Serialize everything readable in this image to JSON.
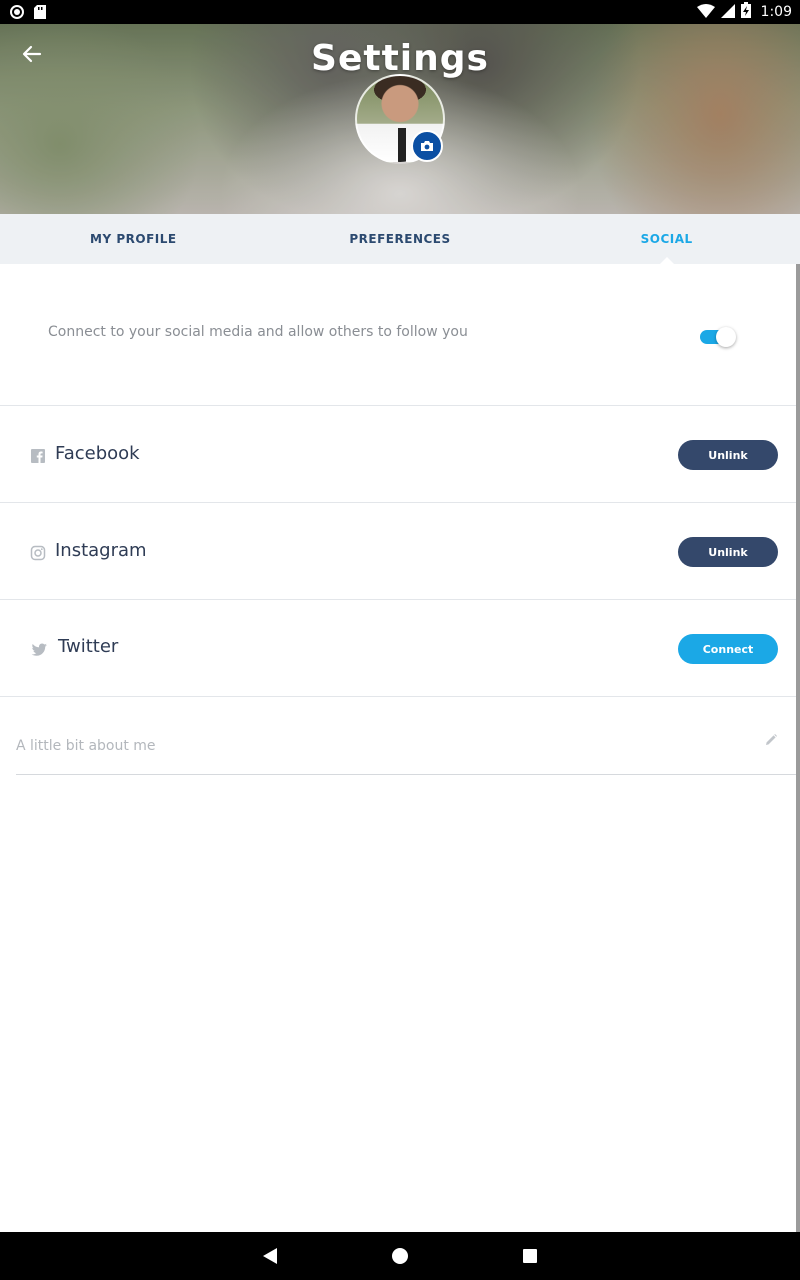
{
  "status_bar": {
    "time": "1:09",
    "icons": [
      "record-icon",
      "sd-card-icon",
      "wifi-icon",
      "signal-icon",
      "battery-charging-icon"
    ]
  },
  "header": {
    "title": "Settings",
    "back_icon": "arrow-left-icon",
    "camera_icon": "camera-icon"
  },
  "tabs": [
    {
      "label": "MY PROFILE",
      "active": false
    },
    {
      "label": "PREFERENCES",
      "active": false
    },
    {
      "label": "SOCIAL",
      "active": true
    }
  ],
  "social": {
    "connect_text": "Connect to your social media and allow others to follow you",
    "connect_enabled": true,
    "accounts": [
      {
        "name": "Facebook",
        "icon": "facebook-icon",
        "action": "Unlink"
      },
      {
        "name": "Instagram",
        "icon": "instagram-icon",
        "action": "Unlink"
      },
      {
        "name": "Twitter",
        "icon": "twitter-icon",
        "action": "Connect"
      }
    ]
  },
  "about": {
    "placeholder": "A little bit about me",
    "value": ""
  },
  "colors": {
    "accent": "#1ba8e6",
    "navy": "#34486b",
    "tab_text": "#2c4a70",
    "tab_bg": "#eef1f4"
  },
  "nav_bar": {
    "buttons": [
      "back-triangle-icon",
      "home-circle-icon",
      "recents-square-icon"
    ]
  }
}
